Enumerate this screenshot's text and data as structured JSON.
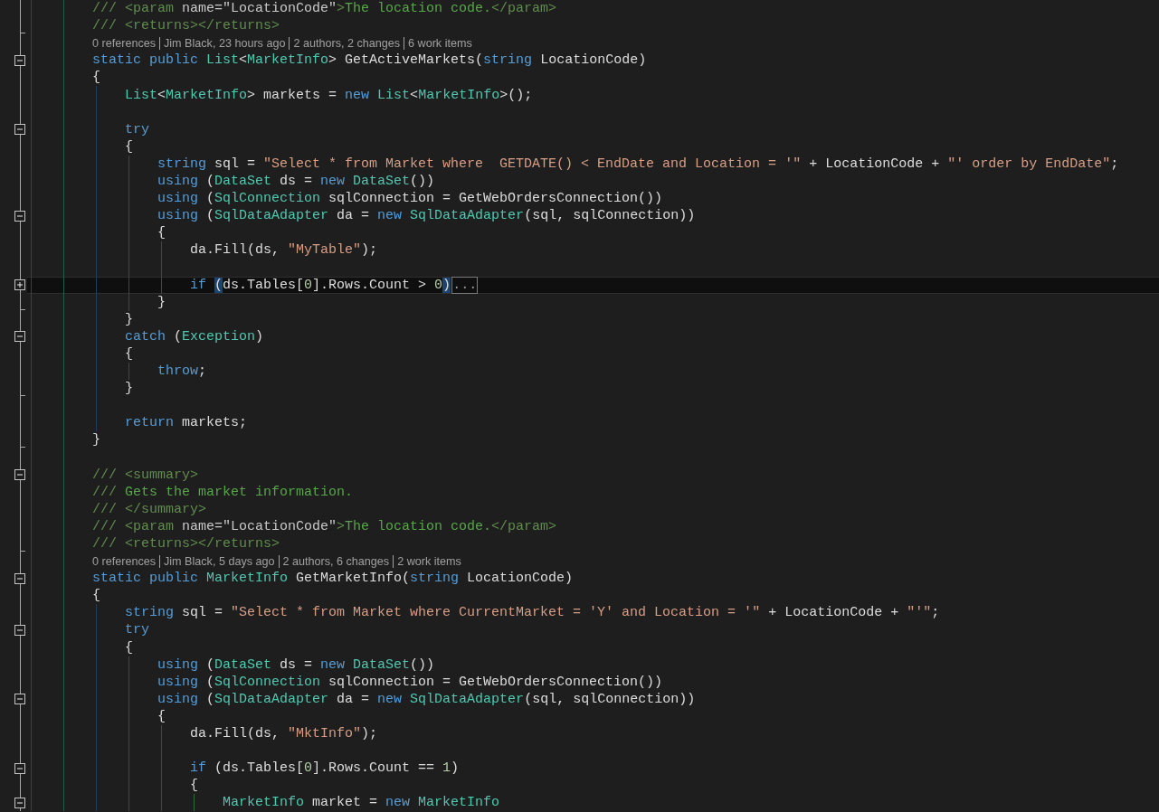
{
  "editor": {
    "lines": [
      {
        "kind": "code",
        "tokens": [
          {
            "kind": "doc_delim",
            "text": "/// <param "
          },
          {
            "kind": "doc_attr",
            "text": "name=\"LocationCode\""
          },
          {
            "kind": "doc_delim",
            "text": ">"
          },
          {
            "kind": "comment",
            "text": "The location code."
          },
          {
            "kind": "doc_delim",
            "text": "</param>"
          }
        ]
      },
      {
        "kind": "code",
        "region_end": true,
        "tokens": [
          {
            "kind": "doc_delim",
            "text": "/// <returns></returns>"
          }
        ]
      },
      {
        "kind": "codelens",
        "items": [
          "0 references",
          "Jim Black, 23 hours ago",
          "2 authors, 2 changes",
          "6 work items"
        ]
      },
      {
        "kind": "code",
        "expanded": true,
        "tokens": [
          {
            "kind": "keyword",
            "text": "static public "
          },
          {
            "kind": "type",
            "text": "List"
          },
          {
            "kind": "plain",
            "text": "<"
          },
          {
            "kind": "type",
            "text": "MarketInfo"
          },
          {
            "kind": "plain",
            "text": "> GetActiveMarkets("
          },
          {
            "kind": "keyword",
            "text": "string"
          },
          {
            "kind": "plain",
            "text": " LocationCode)"
          }
        ]
      },
      {
        "kind": "method_block",
        "tokens": [
          {
            "kind": "plain",
            "text": "{"
          }
        ],
        "children": [
          {
            "kind": "code",
            "tokens": [
              {
                "kind": "type",
                "text": "List"
              },
              {
                "kind": "plain",
                "text": "<"
              },
              {
                "kind": "type",
                "text": "MarketInfo"
              },
              {
                "kind": "plain",
                "text": "> markets = "
              },
              {
                "kind": "keyword",
                "text": "new "
              },
              {
                "kind": "type",
                "text": "List"
              },
              {
                "kind": "plain",
                "text": "<"
              },
              {
                "kind": "type",
                "text": "MarketInfo"
              },
              {
                "kind": "plain",
                "text": ">();"
              }
            ]
          },
          {
            "kind": "blank"
          },
          {
            "kind": "code",
            "expanded": true,
            "tokens": [
              {
                "kind": "keyword",
                "text": "try"
              }
            ]
          },
          {
            "kind": "block",
            "tokens": [
              {
                "kind": "plain",
                "text": "{"
              }
            ],
            "children": [
              {
                "kind": "code",
                "tokens": [
                  {
                    "kind": "keyword",
                    "text": "string"
                  },
                  {
                    "kind": "plain",
                    "text": " sql = "
                  },
                  {
                    "kind": "string",
                    "text": "\"Select * from Market where  GETDATE() < EndDate and Location = '\""
                  },
                  {
                    "kind": "plain",
                    "text": " + LocationCode + "
                  },
                  {
                    "kind": "string",
                    "text": "\"' order by EndDate\""
                  },
                  {
                    "kind": "plain",
                    "text": ";"
                  }
                ]
              },
              {
                "kind": "code",
                "tokens": [
                  {
                    "kind": "keyword",
                    "text": "using"
                  },
                  {
                    "kind": "plain",
                    "text": " ("
                  },
                  {
                    "kind": "type",
                    "text": "DataSet"
                  },
                  {
                    "kind": "plain",
                    "text": " ds = "
                  },
                  {
                    "kind": "keyword",
                    "text": "new "
                  },
                  {
                    "kind": "type",
                    "text": "DataSet"
                  },
                  {
                    "kind": "plain",
                    "text": "())"
                  }
                ]
              },
              {
                "kind": "code",
                "tokens": [
                  {
                    "kind": "keyword",
                    "text": "using"
                  },
                  {
                    "kind": "plain",
                    "text": " ("
                  },
                  {
                    "kind": "type",
                    "text": "SqlConnection"
                  },
                  {
                    "kind": "plain",
                    "text": " sqlConnection = GetWebOrdersConnection())"
                  }
                ]
              },
              {
                "kind": "code",
                "expanded": true,
                "tokens": [
                  {
                    "kind": "keyword",
                    "text": "using"
                  },
                  {
                    "kind": "plain",
                    "text": " ("
                  },
                  {
                    "kind": "type",
                    "text": "SqlDataAdapter"
                  },
                  {
                    "kind": "plain",
                    "text": " da = "
                  },
                  {
                    "kind": "keyword",
                    "text": "new "
                  },
                  {
                    "kind": "type",
                    "text": "SqlDataAdapter"
                  },
                  {
                    "kind": "plain",
                    "text": "(sql, sqlConnection))"
                  }
                ]
              },
              {
                "kind": "block",
                "tokens": [
                  {
                    "kind": "plain",
                    "text": "{"
                  }
                ],
                "children": [
                  {
                    "kind": "code",
                    "tokens": [
                      {
                        "kind": "plain",
                        "text": "da.Fill(ds, "
                      },
                      {
                        "kind": "string",
                        "text": "\"MyTable\""
                      },
                      {
                        "kind": "plain",
                        "text": ");"
                      }
                    ]
                  },
                  {
                    "kind": "blank"
                  },
                  {
                    "kind": "code",
                    "expanded": false,
                    "current": true,
                    "collapsed_hint": "...",
                    "tokens": [
                      {
                        "kind": "keyword",
                        "text": "if "
                      },
                      {
                        "kind": "brace_match",
                        "text": "("
                      },
                      {
                        "kind": "plain",
                        "text": "ds.Tables["
                      },
                      {
                        "kind": "number",
                        "text": "0"
                      },
                      {
                        "kind": "plain",
                        "text": "].Rows.Count > "
                      },
                      {
                        "kind": "number",
                        "text": "0"
                      },
                      {
                        "kind": "brace_match",
                        "text": ")"
                      }
                    ]
                  }
                ]
              },
              {
                "kind": "code",
                "region_end": true,
                "tokens": [
                  {
                    "kind": "plain",
                    "text": "}"
                  }
                ]
              }
            ]
          },
          {
            "kind": "code",
            "tokens": [
              {
                "kind": "plain",
                "text": "}"
              }
            ]
          },
          {
            "kind": "code",
            "expanded": true,
            "tokens": [
              {
                "kind": "keyword",
                "text": "catch"
              },
              {
                "kind": "plain",
                "text": " ("
              },
              {
                "kind": "type",
                "text": "Exception"
              },
              {
                "kind": "plain",
                "text": ")"
              }
            ]
          },
          {
            "kind": "block",
            "tokens": [
              {
                "kind": "plain",
                "text": "{"
              }
            ],
            "children": [
              {
                "kind": "code",
                "tokens": [
                  {
                    "kind": "keyword",
                    "text": "throw"
                  },
                  {
                    "kind": "plain",
                    "text": ";"
                  }
                ]
              }
            ]
          },
          {
            "kind": "code",
            "region_end": true,
            "tokens": [
              {
                "kind": "plain",
                "text": "}"
              }
            ]
          },
          {
            "kind": "blank"
          },
          {
            "kind": "code",
            "tokens": [
              {
                "kind": "keyword",
                "text": "return"
              },
              {
                "kind": "plain",
                "text": " markets;"
              }
            ]
          }
        ]
      },
      {
        "kind": "code",
        "region_end": true,
        "tokens": [
          {
            "kind": "plain",
            "text": "}"
          }
        ]
      },
      {
        "kind": "blank"
      },
      {
        "kind": "code",
        "expanded": true,
        "tokens": [
          {
            "kind": "doc_delim",
            "text": "/// <summary>"
          }
        ]
      },
      {
        "kind": "code",
        "tokens": [
          {
            "kind": "doc_delim",
            "text": "///"
          },
          {
            "kind": "comment",
            "text": " Gets the market information."
          }
        ]
      },
      {
        "kind": "code",
        "tokens": [
          {
            "kind": "doc_delim",
            "text": "/// </summary>"
          }
        ]
      },
      {
        "kind": "code",
        "tokens": [
          {
            "kind": "doc_delim",
            "text": "/// <param "
          },
          {
            "kind": "doc_attr",
            "text": "name=\"LocationCode\""
          },
          {
            "kind": "doc_delim",
            "text": ">"
          },
          {
            "kind": "comment",
            "text": "The location code."
          },
          {
            "kind": "doc_delim",
            "text": "</param>"
          }
        ]
      },
      {
        "kind": "code",
        "region_end": true,
        "tokens": [
          {
            "kind": "doc_delim",
            "text": "/// <returns></returns>"
          }
        ]
      },
      {
        "kind": "codelens",
        "items": [
          "0 references",
          "Jim Black, 5 days ago",
          "2 authors, 6 changes",
          "2 work items"
        ]
      },
      {
        "kind": "code",
        "expanded": true,
        "tokens": [
          {
            "kind": "keyword",
            "text": "static public "
          },
          {
            "kind": "type",
            "text": "MarketInfo"
          },
          {
            "kind": "plain",
            "text": " GetMarketInfo("
          },
          {
            "kind": "keyword",
            "text": "string"
          },
          {
            "kind": "plain",
            "text": " LocationCode)"
          }
        ]
      },
      {
        "kind": "method_block",
        "tokens": [
          {
            "kind": "plain",
            "text": "{"
          }
        ],
        "children": [
          {
            "kind": "code",
            "tokens": [
              {
                "kind": "keyword",
                "text": "string"
              },
              {
                "kind": "plain",
                "text": " sql = "
              },
              {
                "kind": "string",
                "text": "\"Select * from Market where CurrentMarket = 'Y' and Location = '\""
              },
              {
                "kind": "plain",
                "text": " + LocationCode + "
              },
              {
                "kind": "string",
                "text": "\"'\""
              },
              {
                "kind": "plain",
                "text": ";"
              }
            ]
          },
          {
            "kind": "code",
            "expanded": true,
            "tokens": [
              {
                "kind": "keyword",
                "text": "try"
              }
            ]
          },
          {
            "kind": "block",
            "tokens": [
              {
                "kind": "plain",
                "text": "{"
              }
            ],
            "children": [
              {
                "kind": "code",
                "tokens": [
                  {
                    "kind": "keyword",
                    "text": "using"
                  },
                  {
                    "kind": "plain",
                    "text": " ("
                  },
                  {
                    "kind": "type",
                    "text": "DataSet"
                  },
                  {
                    "kind": "plain",
                    "text": " ds = "
                  },
                  {
                    "kind": "keyword",
                    "text": "new "
                  },
                  {
                    "kind": "type",
                    "text": "DataSet"
                  },
                  {
                    "kind": "plain",
                    "text": "())"
                  }
                ]
              },
              {
                "kind": "code",
                "tokens": [
                  {
                    "kind": "keyword",
                    "text": "using"
                  },
                  {
                    "kind": "plain",
                    "text": " ("
                  },
                  {
                    "kind": "type",
                    "text": "SqlConnection"
                  },
                  {
                    "kind": "plain",
                    "text": " sqlConnection = GetWebOrdersConnection())"
                  }
                ]
              },
              {
                "kind": "code",
                "expanded": true,
                "tokens": [
                  {
                    "kind": "keyword",
                    "text": "using"
                  },
                  {
                    "kind": "plain",
                    "text": " ("
                  },
                  {
                    "kind": "type",
                    "text": "SqlDataAdapter"
                  },
                  {
                    "kind": "plain",
                    "text": " da = "
                  },
                  {
                    "kind": "keyword",
                    "text": "new "
                  },
                  {
                    "kind": "type",
                    "text": "SqlDataAdapter"
                  },
                  {
                    "kind": "plain",
                    "text": "(sql, sqlConnection))"
                  }
                ]
              },
              {
                "kind": "block",
                "tokens": [
                  {
                    "kind": "plain",
                    "text": "{"
                  }
                ],
                "children": [
                  {
                    "kind": "code",
                    "tokens": [
                      {
                        "kind": "plain",
                        "text": "da.Fill(ds, "
                      },
                      {
                        "kind": "string",
                        "text": "\"MktInfo\""
                      },
                      {
                        "kind": "plain",
                        "text": ");"
                      }
                    ]
                  },
                  {
                    "kind": "blank"
                  },
                  {
                    "kind": "code",
                    "expanded": true,
                    "tokens": [
                      {
                        "kind": "keyword",
                        "text": "if"
                      },
                      {
                        "kind": "plain",
                        "text": " (ds.Tables["
                      },
                      {
                        "kind": "number",
                        "text": "0"
                      },
                      {
                        "kind": "plain",
                        "text": "].Rows.Count == "
                      },
                      {
                        "kind": "number",
                        "text": "1"
                      },
                      {
                        "kind": "plain",
                        "text": ")"
                      }
                    ]
                  },
                  {
                    "kind": "conditional_block",
                    "tokens": [
                      {
                        "kind": "plain",
                        "text": "{"
                      }
                    ],
                    "children": [
                      {
                        "kind": "code",
                        "expanded": true,
                        "tokens": [
                          {
                            "kind": "type",
                            "text": "MarketInfo"
                          },
                          {
                            "kind": "plain",
                            "text": " market = "
                          },
                          {
                            "kind": "keyword",
                            "text": "new "
                          },
                          {
                            "kind": "type",
                            "text": "MarketInfo"
                          }
                        ]
                      }
                    ]
                  }
                ]
              }
            ]
          }
        ]
      }
    ]
  }
}
